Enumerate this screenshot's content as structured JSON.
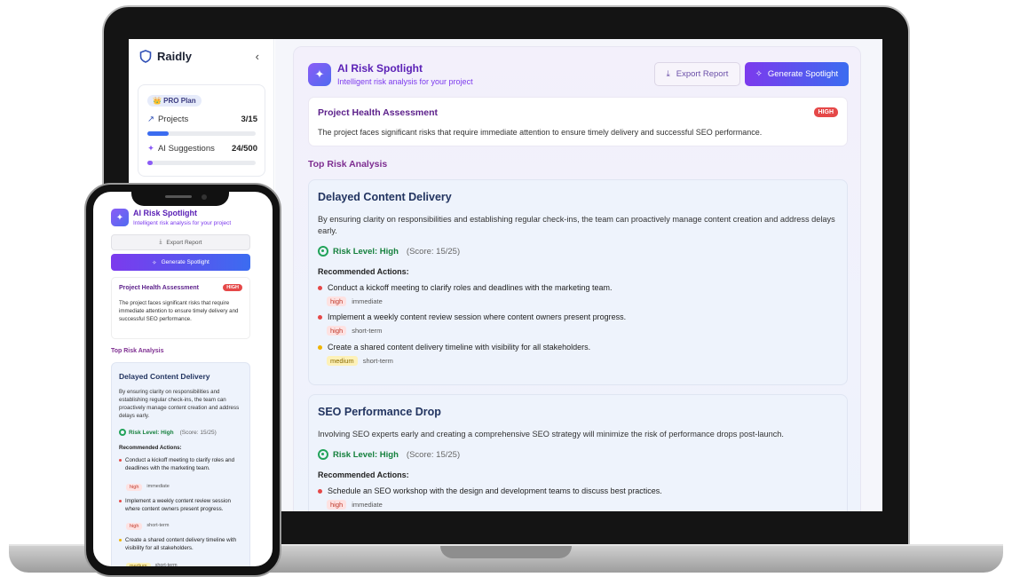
{
  "colors": {
    "accent": "#7c3aed",
    "accent_blue": "#3b6cf0",
    "risk_high": "#e54848",
    "risk_medium": "#f0b400",
    "level_ok": "#22a35a"
  },
  "sidebar": {
    "brand": "Raidly",
    "collapse_icon": "chevron-left-icon",
    "plan_badge": "👑 PRO Plan",
    "usage": [
      {
        "label": "Projects",
        "value": "3/15",
        "progress": 0.2,
        "icon": "trend-up-icon"
      },
      {
        "label": "AI Suggestions",
        "value": "24/500",
        "progress": 0.05,
        "icon": "sparkles-icon"
      }
    ]
  },
  "header": {
    "title": "AI Risk Spotlight",
    "subtitle": "Intelligent risk analysis for your project",
    "export_label": "Export Report",
    "generate_label": "Generate Spotlight"
  },
  "health": {
    "title": "Project Health Assessment",
    "badge": "HIGH",
    "text": "The project faces significant risks that require immediate attention to ensure timely delivery and successful SEO performance.",
    "mobile_text": "The project faces significant risks that require immediate attention to ensure timely delivery and successful SEO performance."
  },
  "section_title": "Top Risk Analysis",
  "risks": [
    {
      "title": "Delayed Content Delivery",
      "description": "By ensuring clarity on responsibilities and establishing regular check-ins, the team can proactively manage content creation and address delays early.",
      "level": "Risk Level: High",
      "score": "(Score: 15/25)",
      "rec_label": "Recommended Actions:",
      "actions": [
        {
          "text": "Conduct a kickoff meeting to clarify roles and deadlines with the marketing team.",
          "priority": "high",
          "timeline": "immediate"
        },
        {
          "text": "Implement a weekly content review session where content owners present progress.",
          "priority": "high",
          "timeline": "short-term"
        },
        {
          "text": "Create a shared content delivery timeline with visibility for all stakeholders.",
          "priority": "medium",
          "timeline": "short-term"
        }
      ]
    },
    {
      "title": "SEO Performance Drop",
      "description": "Involving SEO experts early and creating a comprehensive SEO strategy will minimize the risk of performance drops post-launch.",
      "level": "Risk Level: High",
      "score": "(Score: 15/25)",
      "rec_label": "Recommended Actions:",
      "actions": [
        {
          "text": "Schedule an SEO workshop with the design and development teams to discuss best practices.",
          "priority": "high",
          "timeline": "immediate"
        }
      ]
    }
  ]
}
